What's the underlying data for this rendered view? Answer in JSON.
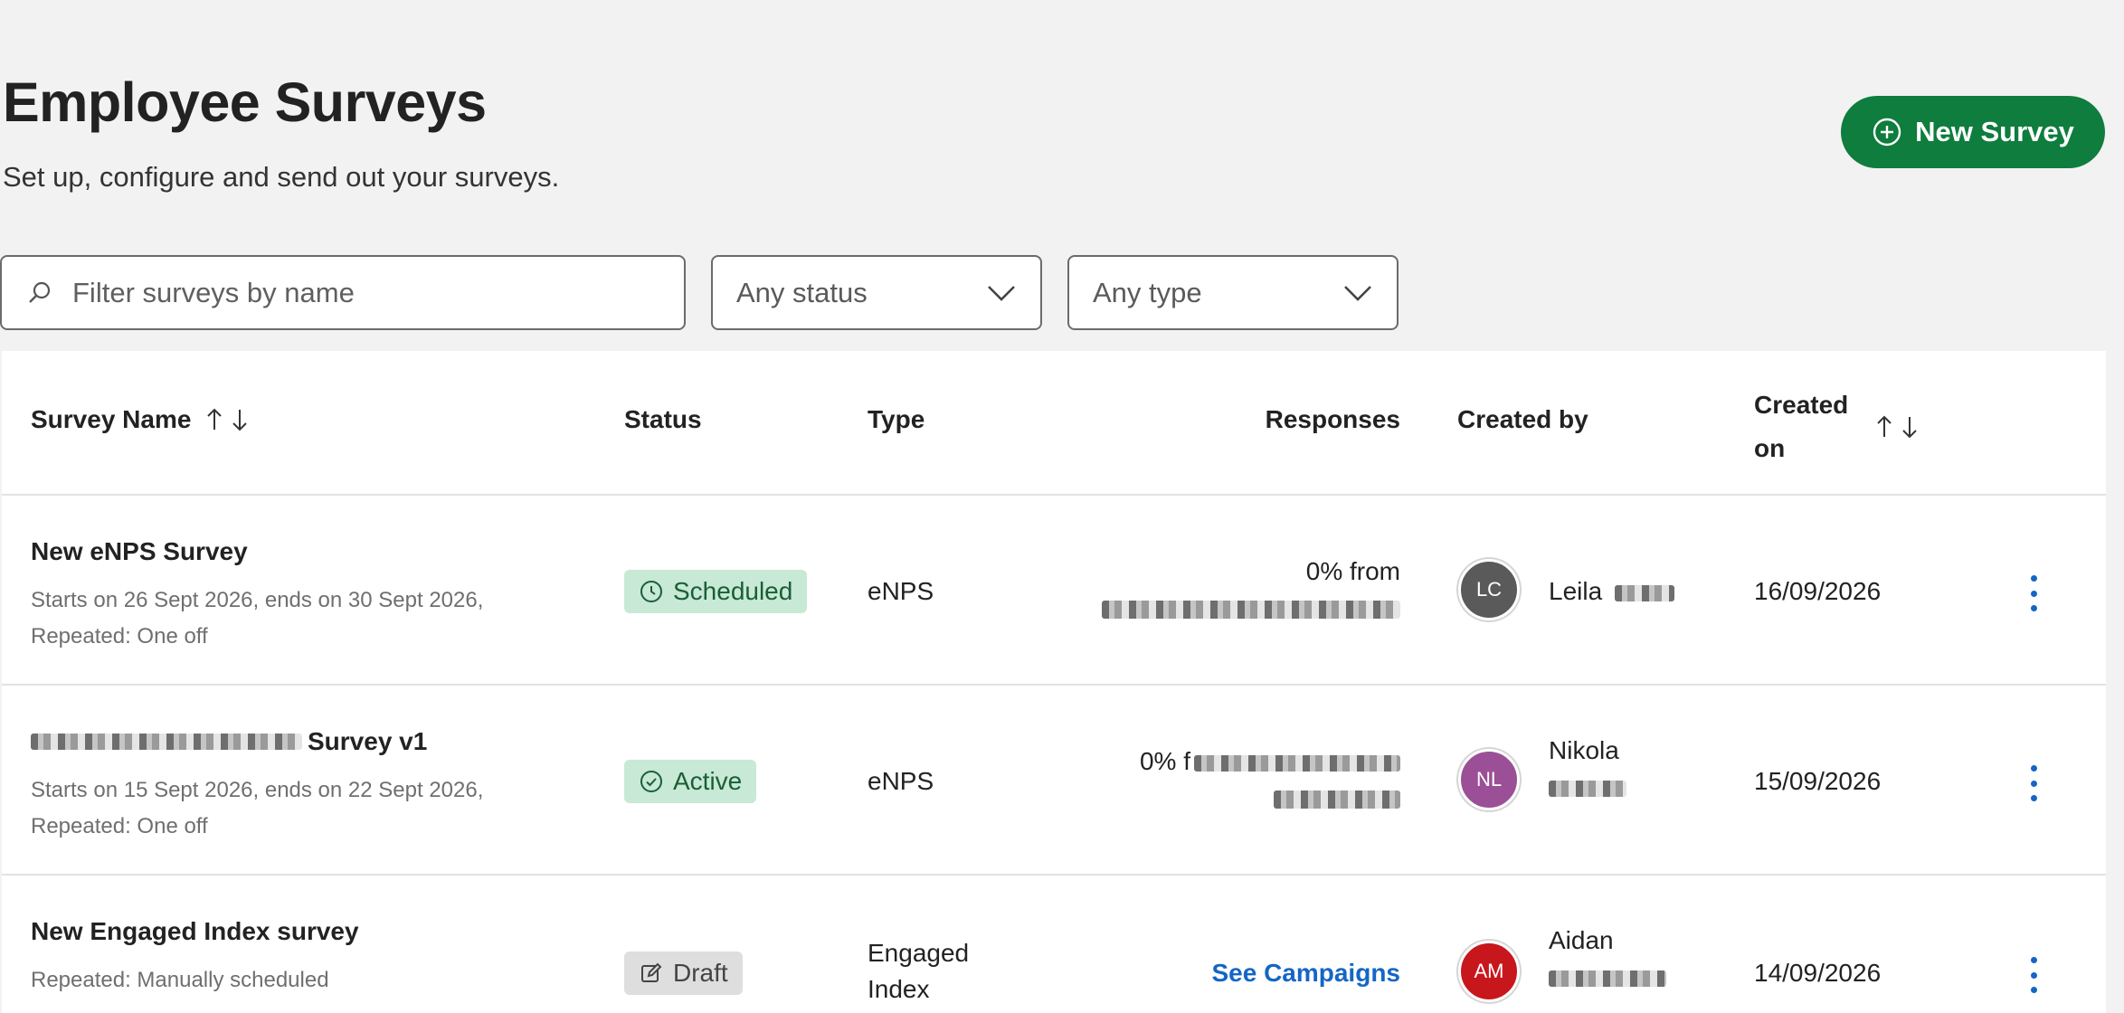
{
  "header": {
    "title": "Employee Surveys",
    "subtitle": "Set up, configure and send out your surveys.",
    "new_survey_label": "New Survey"
  },
  "filters": {
    "search_placeholder": "Filter surveys by name",
    "status_value": "Any status",
    "type_value": "Any type"
  },
  "table": {
    "columns": {
      "name": "Survey Name",
      "status": "Status",
      "type": "Type",
      "responses": "Responses",
      "created_by": "Created by",
      "created_on_1": "Created",
      "created_on_2": "on"
    },
    "rows": [
      {
        "name": "New eNPS Survey",
        "desc_1": "Starts on 26 Sept 2026, ends on 30 Sept 2026,",
        "desc_2": "Repeated: One off",
        "status": "Scheduled",
        "type_1": "eNPS",
        "type_2": "",
        "responses": "0% from",
        "creator_initials": "LC",
        "creator_name_1": "Leila",
        "creator_name_2": "",
        "created_on": "16/09/2026"
      },
      {
        "name": "Survey v1",
        "desc_1": "Starts on 15 Sept 2026, ends on 22 Sept 2026,",
        "desc_2": "Repeated: One off",
        "status": "Active",
        "type_1": "eNPS",
        "type_2": "",
        "responses": "0% f",
        "creator_initials": "NL",
        "creator_name_1": "Nikola",
        "creator_name_2": "",
        "created_on": "15/09/2026"
      },
      {
        "name": "New Engaged Index survey",
        "desc_1": "Repeated: Manually scheduled",
        "desc_2": "",
        "status": "Draft",
        "type_1": "Engaged",
        "type_2": "Index",
        "responses": "See Campaigns",
        "creator_initials": "AM",
        "creator_name_1": "Aidan",
        "creator_name_2": "",
        "created_on": "14/09/2026"
      }
    ]
  },
  "colors": {
    "primary": "#0e7d3d",
    "link": "#1466c5",
    "badge_green_bg": "#c7e9d6",
    "badge_grey_bg": "#dedede",
    "avatar_lc": "#5a5a5a",
    "avatar_nl": "#9b4f96",
    "avatar_am": "#c8161d"
  }
}
